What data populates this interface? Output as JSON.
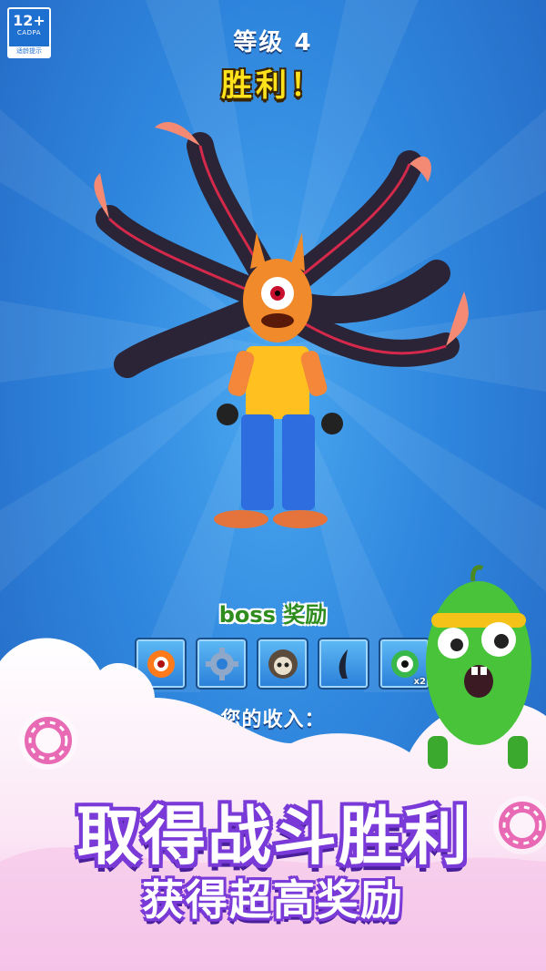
{
  "age_rating": {
    "number": "12+",
    "org": "CADPA",
    "tip": "适龄提示"
  },
  "level_title": "等级 4",
  "result": "胜利！",
  "boss_reward": {
    "label": "boss 奖励",
    "items": [
      {
        "icon": "sun-eye-icon",
        "multiplier": ""
      },
      {
        "icon": "gear-icon",
        "multiplier": ""
      },
      {
        "icon": "skull-hood-icon",
        "multiplier": ""
      },
      {
        "icon": "horn-icon",
        "multiplier": ""
      },
      {
        "icon": "eyeball-icon",
        "multiplier": "x2"
      }
    ]
  },
  "income_label": "您的收入：",
  "promo": {
    "headline": "取得战斗胜利",
    "subline": "获得超高奖励"
  },
  "colors": {
    "victory": "#ffe21c",
    "reward_label": "#2f8d1f",
    "promo_outline": "#7a3ad8"
  }
}
